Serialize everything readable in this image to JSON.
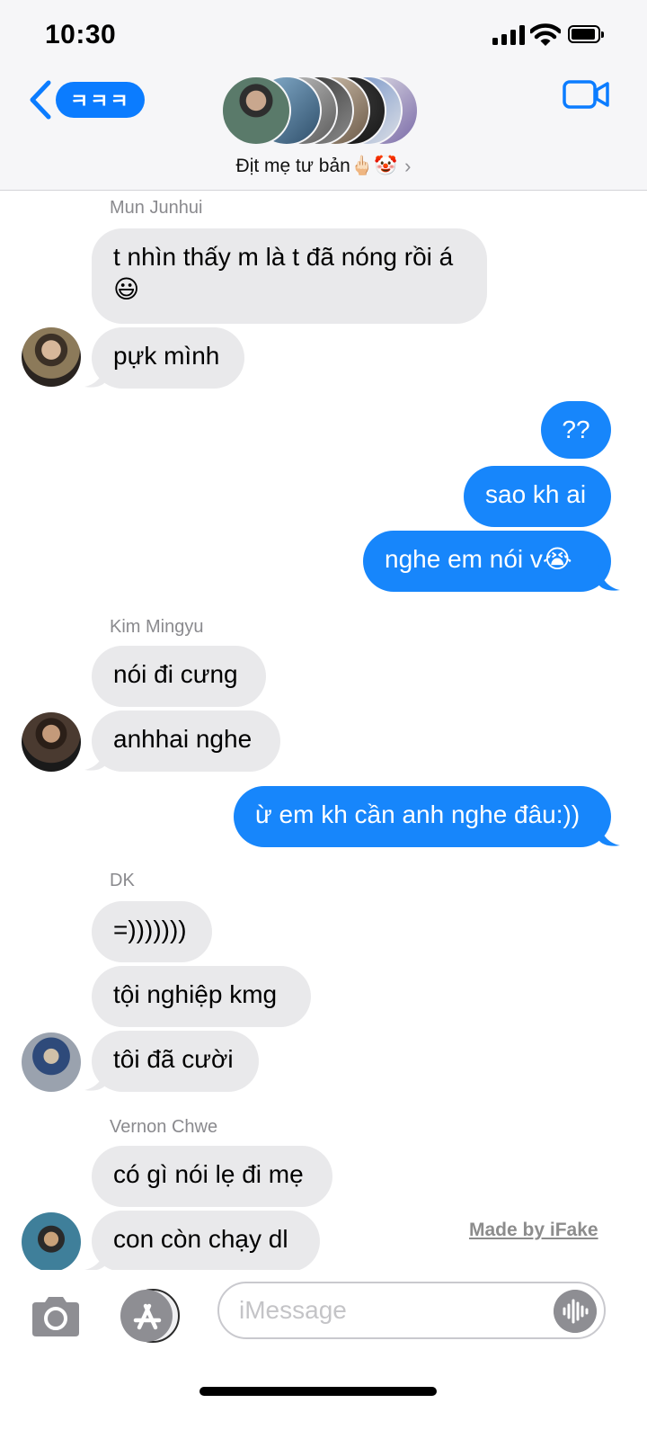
{
  "status_bar": {
    "time": "10:30"
  },
  "header": {
    "back_badge": "ㅋㅋㅋ",
    "group_name": "Địt mẹ tư bản🖕🏻🤡",
    "chevron": "›",
    "icons": {
      "back": "chevron-left-icon",
      "video": "video-camera-icon",
      "details": "chevron-right-icon"
    }
  },
  "messages": [
    {
      "sender": "Mun Junhui",
      "bubbles": [
        "t nhìn thấy m là t đã nóng rồi á\n😃",
        "pựk mình"
      ]
    },
    {
      "outgoing": [
        "??",
        "sao kh ai",
        "nghe em nói v😭"
      ]
    },
    {
      "sender": "Kim Mingyu",
      "bubbles": [
        "nói đi cưng",
        "anhhai nghe"
      ]
    },
    {
      "outgoing": [
        "ừ em kh cần anh nghe đâu:))"
      ]
    },
    {
      "sender": "DK",
      "bubbles": [
        "=)))))))",
        "tội nghiệp kmg",
        "tôi đã cười"
      ]
    },
    {
      "sender": "Vernon Chwe",
      "bubbles": [
        "có gì nói lẹ đi mẹ",
        "con còn chạy dl"
      ]
    }
  ],
  "watermark": "Made by iFake",
  "input_bar": {
    "placeholder": "iMessage",
    "icons": [
      "camera-icon",
      "app-store-icon",
      "audio-waveform-icon"
    ]
  },
  "colors": {
    "accent": "#0b7cff",
    "outgoing_bubble": "#1786fb",
    "incoming_bubble": "#e9e9eb",
    "header_bg": "#f6f6f8"
  }
}
